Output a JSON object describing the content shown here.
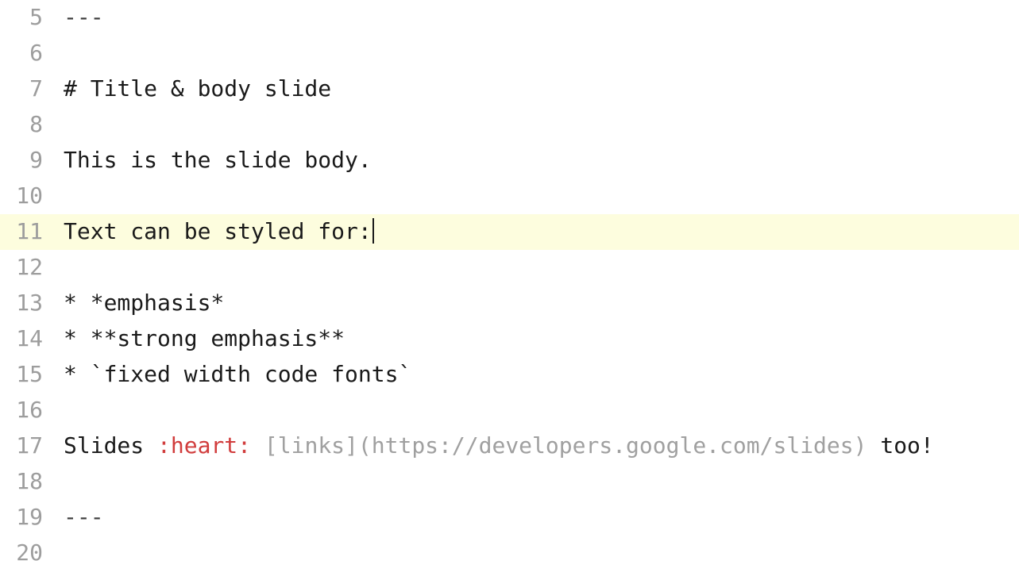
{
  "editor": {
    "lines": [
      {
        "num": "5",
        "segs": [
          {
            "t": "---",
            "c": "hr-dash"
          }
        ]
      },
      {
        "num": "6",
        "segs": []
      },
      {
        "num": "7",
        "segs": [
          {
            "t": "# Title & body slide",
            "c": "plain"
          }
        ]
      },
      {
        "num": "8",
        "segs": []
      },
      {
        "num": "9",
        "segs": [
          {
            "t": "This is the slide body.",
            "c": "plain"
          }
        ]
      },
      {
        "num": "10",
        "segs": []
      },
      {
        "num": "11",
        "segs": [
          {
            "t": "Text can be styled for:",
            "c": "plain"
          }
        ],
        "highlighted": true,
        "cursor": true
      },
      {
        "num": "12",
        "segs": []
      },
      {
        "num": "13",
        "segs": [
          {
            "t": "* *emphasis*",
            "c": "plain"
          }
        ]
      },
      {
        "num": "14",
        "segs": [
          {
            "t": "* **strong emphasis**",
            "c": "plain"
          }
        ]
      },
      {
        "num": "15",
        "segs": [
          {
            "t": "* `fixed width code fonts`",
            "c": "plain"
          }
        ]
      },
      {
        "num": "16",
        "segs": []
      },
      {
        "num": "17",
        "segs": [
          {
            "t": "Slides ",
            "c": "plain"
          },
          {
            "t": ":heart:",
            "c": "colored-heart"
          },
          {
            "t": " ",
            "c": "plain"
          },
          {
            "t": "[links](https://developers.google.com/slides)",
            "c": "link-gray"
          },
          {
            "t": " too!",
            "c": "plain"
          }
        ]
      },
      {
        "num": "18",
        "segs": []
      },
      {
        "num": "19",
        "segs": [
          {
            "t": "---",
            "c": "hr-dash"
          }
        ]
      },
      {
        "num": "20",
        "segs": []
      }
    ]
  }
}
